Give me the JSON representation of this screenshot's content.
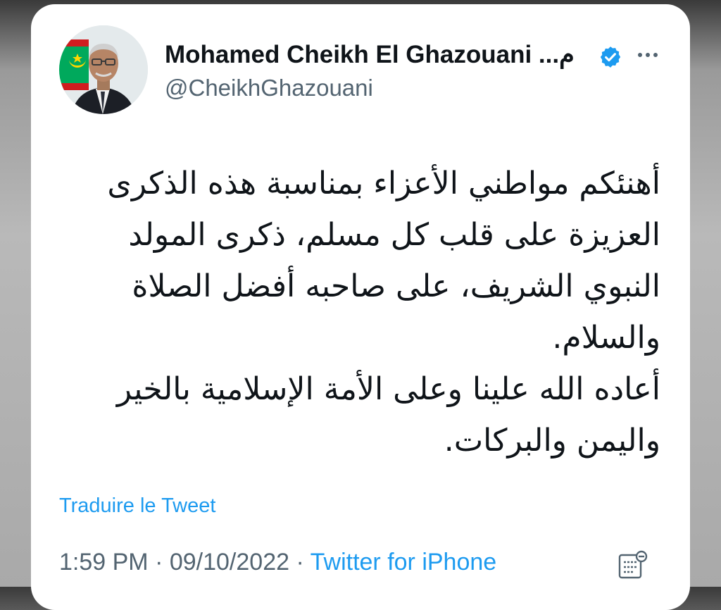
{
  "tweet": {
    "author": {
      "name": "Mohamed Cheikh El Ghazouani ...م",
      "handle": "@CheikhGhazouani",
      "verified_icon": "verified-badge-icon",
      "avatar_icon": "profile-avatar"
    },
    "more_icon": "more-options-icon",
    "text_lines": [
      "أهنئكم مواطني الأعزاء بمناسبة هذه الذكرى العزيزة على قلب كل مسلم، ذكرى المولد النبوي الشريف، على صاحبه أفضل الصلاة والسلام.",
      "أعاده الله علينا وعلى الأمة الإسلامية بالخير واليمن والبركات."
    ],
    "translate_label": "Traduire le Tweet",
    "time": "1:59 PM",
    "separator": " · ",
    "date": "09/10/2022",
    "source": "Twitter for iPhone",
    "analytics_icon": "analytics-icon"
  },
  "colors": {
    "accent": "#1d9bf0",
    "text_primary": "#0f1419",
    "text_secondary": "#536471"
  }
}
